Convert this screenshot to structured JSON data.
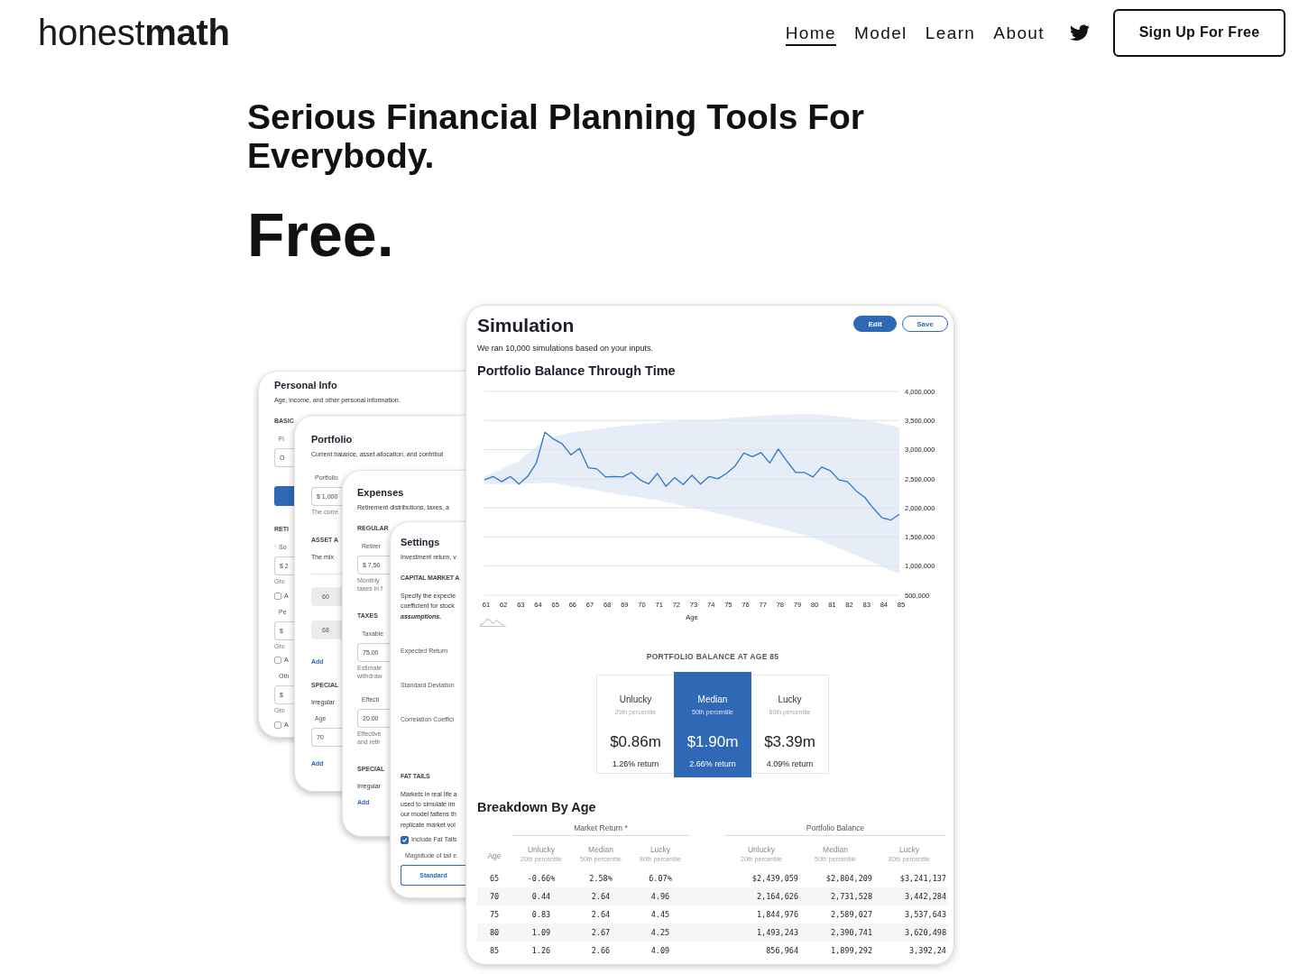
{
  "header": {
    "logo": "honest**math**",
    "nav": [
      {
        "label": "Home",
        "selected": true
      },
      {
        "label": "Model",
        "selected": false
      },
      {
        "label": "Learn",
        "selected": false
      },
      {
        "label": "About",
        "selected": false
      }
    ],
    "signup": "Sign Up For Free"
  },
  "hero": {
    "title": "Serious Financial Planning Tools For Everybody.",
    "tagline": "Free."
  },
  "back_cards": [
    {
      "title": "Personal Info",
      "description": "Age, income, and other personal information.",
      "items": [
        {
          "kind": "section",
          "text": "BASIC"
        },
        {
          "kind": "label",
          "text": "Fi"
        },
        {
          "kind": "field",
          "value": "O",
          "disabled": false
        },
        {
          "kind": "button"
        },
        {
          "kind": "section",
          "text": "RETI"
        },
        {
          "kind": "label",
          "text": "So"
        },
        {
          "kind": "field",
          "value": "$ 2",
          "disabled": false
        },
        {
          "kind": "hint",
          "lines": [
            "Gro"
          ]
        },
        {
          "kind": "checkbox",
          "text": "A",
          "checked": false
        },
        {
          "kind": "label",
          "text": "Pe"
        },
        {
          "kind": "field",
          "value": "$",
          "disabled": false
        },
        {
          "kind": "hint",
          "lines": [
            "Gro"
          ]
        },
        {
          "kind": "checkbox",
          "text": "A",
          "checked": false
        },
        {
          "kind": "label",
          "text": "Oth"
        },
        {
          "kind": "field",
          "value": "$",
          "disabled": false
        },
        {
          "kind": "hint",
          "lines": [
            "Gro"
          ]
        },
        {
          "kind": "checkbox",
          "text": "A",
          "checked": false
        }
      ]
    },
    {
      "title": "Portfolio",
      "description": "Current balance, asset allocation, and contribut",
      "items": [
        {
          "kind": "label",
          "text": "Portfolio"
        },
        {
          "kind": "field",
          "value": "$ 1,000",
          "disabled": false
        },
        {
          "kind": "hint",
          "lines": [
            "The curre"
          ]
        },
        {
          "kind": "section",
          "text": "ASSET A"
        },
        {
          "kind": "text",
          "text": "The mix"
        },
        {
          "kind": "divider"
        },
        {
          "kind": "field",
          "value": "60",
          "disabled": true
        },
        {
          "kind": "field",
          "value": "68",
          "disabled": true
        },
        {
          "kind": "link",
          "text": "Add"
        },
        {
          "kind": "section",
          "text": "SPECIAL"
        },
        {
          "kind": "text",
          "text": "Irregular"
        },
        {
          "kind": "label",
          "text": "Age"
        },
        {
          "kind": "field",
          "value": "70",
          "disabled": false
        },
        {
          "kind": "link",
          "text": "Add"
        }
      ]
    },
    {
      "title": "Expenses",
      "description": "Retirement distributions, taxes, a",
      "items": [
        {
          "kind": "section",
          "text": "REGULAR"
        },
        {
          "kind": "label",
          "text": "Retirer"
        },
        {
          "kind": "field",
          "value": "$ 7,50",
          "disabled": false
        },
        {
          "kind": "hint",
          "lines": [
            "Monthly",
            "taxes in f"
          ]
        },
        {
          "kind": "section",
          "text": "TAXES"
        },
        {
          "kind": "label",
          "text": "Taxable"
        },
        {
          "kind": "field",
          "value": "75.00",
          "disabled": false
        },
        {
          "kind": "hint",
          "lines": [
            "Estimate",
            "withdraw"
          ]
        },
        {
          "kind": "label",
          "text": "Effecti"
        },
        {
          "kind": "field",
          "value": "20.00",
          "disabled": false
        },
        {
          "kind": "hint",
          "lines": [
            "Effective",
            "and retir"
          ]
        },
        {
          "kind": "section",
          "text": "SPECIAL"
        },
        {
          "kind": "text",
          "text": "Irregular"
        },
        {
          "kind": "link",
          "text": "Add"
        }
      ]
    },
    {
      "title": "Settings",
      "description": "Investment return, v",
      "items": [
        {
          "kind": "section",
          "text": "CAPITAL MARKET A"
        },
        {
          "kind": "paragraph",
          "lines": [
            "Specify the expecte",
            "coefficient for stock",
            "**assumptions.**"
          ]
        },
        {
          "kind": "row_label",
          "text": "Expected Return"
        },
        {
          "kind": "row_label",
          "text": "Standard Deviation"
        },
        {
          "kind": "row_label",
          "text": "Correlation Coeffici"
        },
        {
          "kind": "section",
          "text": "FAT TAILS"
        },
        {
          "kind": "paragraph",
          "lines": [
            "Markets in real life a",
            "used to simulate im",
            "our model fattens th",
            "replicate market vol"
          ]
        },
        {
          "kind": "checkbox",
          "text": "Include Fat Tails",
          "checked": true
        },
        {
          "kind": "label",
          "text": "Magnitude of tail e"
        },
        {
          "kind": "outline_button",
          "text": "Standard"
        }
      ]
    }
  ],
  "simulation": {
    "title": "Simulation",
    "buttons": [
      {
        "label": "Edit",
        "kind": "primary"
      },
      {
        "label": "Save",
        "kind": "outline"
      }
    ],
    "subtitle": "We ran 10,000 simulations based on your inputs.",
    "chart_data": {
      "type": "line",
      "title": "Portfolio Balance Through Time",
      "xlabel": "Age",
      "grid": true,
      "x": [
        61,
        61.5,
        62,
        62.5,
        63,
        63.5,
        64,
        64.5,
        65,
        65.5,
        66,
        66.5,
        67,
        67.5,
        68,
        68.5,
        69,
        69.5,
        70,
        70.5,
        71,
        71.5,
        72,
        72.5,
        73,
        73.5,
        74,
        74.5,
        75,
        75.5,
        76,
        76.5,
        77,
        77.5,
        78,
        78.5,
        79,
        79.5,
        80,
        80.5,
        81,
        81.5,
        82,
        82.5,
        83,
        83.5,
        84,
        84.5,
        85
      ],
      "xlim": [
        61,
        85
      ],
      "ylim": [
        500000,
        4000000
      ],
      "xticks": [
        61,
        62,
        63,
        64,
        65,
        66,
        67,
        68,
        69,
        70,
        71,
        72,
        73,
        74,
        75,
        76,
        77,
        78,
        79,
        80,
        81,
        82,
        83,
        84,
        85
      ],
      "yticks": [
        {
          "value": 500000,
          "label": "500,000"
        },
        {
          "value": 1000000,
          "label": "1,000,000"
        },
        {
          "value": 1500000,
          "label": "1,500,000"
        },
        {
          "value": 2000000,
          "label": "2,000,000"
        },
        {
          "value": 2500000,
          "label": "2,500,000"
        },
        {
          "value": 3000000,
          "label": "3,000,000"
        },
        {
          "value": 3500000,
          "label": "3,500,000"
        },
        {
          "value": 4000000,
          "label": "4,000,000"
        }
      ],
      "series": [
        {
          "color": "#2a78c8",
          "values": [
            2480000,
            2540000,
            2450000,
            2540000,
            2410000,
            2540000,
            2770000,
            3300000,
            3180000,
            3100000,
            2910000,
            3020000,
            2690000,
            2670000,
            2530000,
            2540000,
            2530000,
            2610000,
            2480000,
            2410000,
            2590000,
            2370000,
            2520000,
            2400000,
            2560000,
            2410000,
            2540000,
            2500000,
            2590000,
            2720000,
            2940000,
            2880000,
            2950000,
            2770000,
            3010000,
            2800000,
            2610000,
            2610000,
            2530000,
            2700000,
            2640000,
            2480000,
            2450000,
            2290000,
            2180000,
            1990000,
            1830000,
            1790000,
            1890000
          ]
        }
      ]
    },
    "summary": {
      "heading": "PORTFOLIO BALANCE AT AGE 85",
      "cards": [
        {
          "label": "Unlucky",
          "percentile": "20th percentile",
          "amount": "$0.86m",
          "return": "1.26% return",
          "selected": false
        },
        {
          "label": "Median",
          "percentile": "50th percentile",
          "amount": "$1.90m",
          "return": "2.66% return",
          "selected": true
        },
        {
          "label": "Lucky",
          "percentile": "80th percentile",
          "amount": "$3.39m",
          "return": "4.09% return",
          "selected": false
        }
      ]
    },
    "breakdown": {
      "title": "Breakdown By Age",
      "groups": [
        "Market Return *",
        "Portfolio Balance"
      ],
      "columns": [
        {
          "label": "Age"
        },
        {
          "label": "Unlucky",
          "sublabel": "20th percentile"
        },
        {
          "label": "Median",
          "sublabel": "50th percentile"
        },
        {
          "label": "Lucky",
          "sublabel": "80th percentile"
        },
        {
          "label": "Unlucky",
          "sublabel": "20th percentile"
        },
        {
          "label": "Median",
          "sublabel": "50th percentile"
        },
        {
          "label": "Lucky",
          "sublabel": "80th percentile"
        }
      ],
      "rows": [
        [
          "65",
          "-0.66%",
          "2.58%",
          "6.07%",
          "$2,439,059",
          "$2,804,209",
          "$3,241,137"
        ],
        [
          "70",
          "0.44",
          "2.64",
          "4.96",
          "2,164,626",
          "2,731,528",
          "3,442,284"
        ],
        [
          "75",
          "0.83",
          "2.64",
          "4.45",
          "1,844,976",
          "2,589,027",
          "3,537,643"
        ],
        [
          "80",
          "1.09",
          "2.67",
          "4.25",
          "1,493,243",
          "2,390,741",
          "3,620,498"
        ],
        [
          "85",
          "1.26",
          "2.66",
          "4.09",
          "856,964",
          "1,899,292",
          "3,392,24"
        ]
      ]
    }
  }
}
